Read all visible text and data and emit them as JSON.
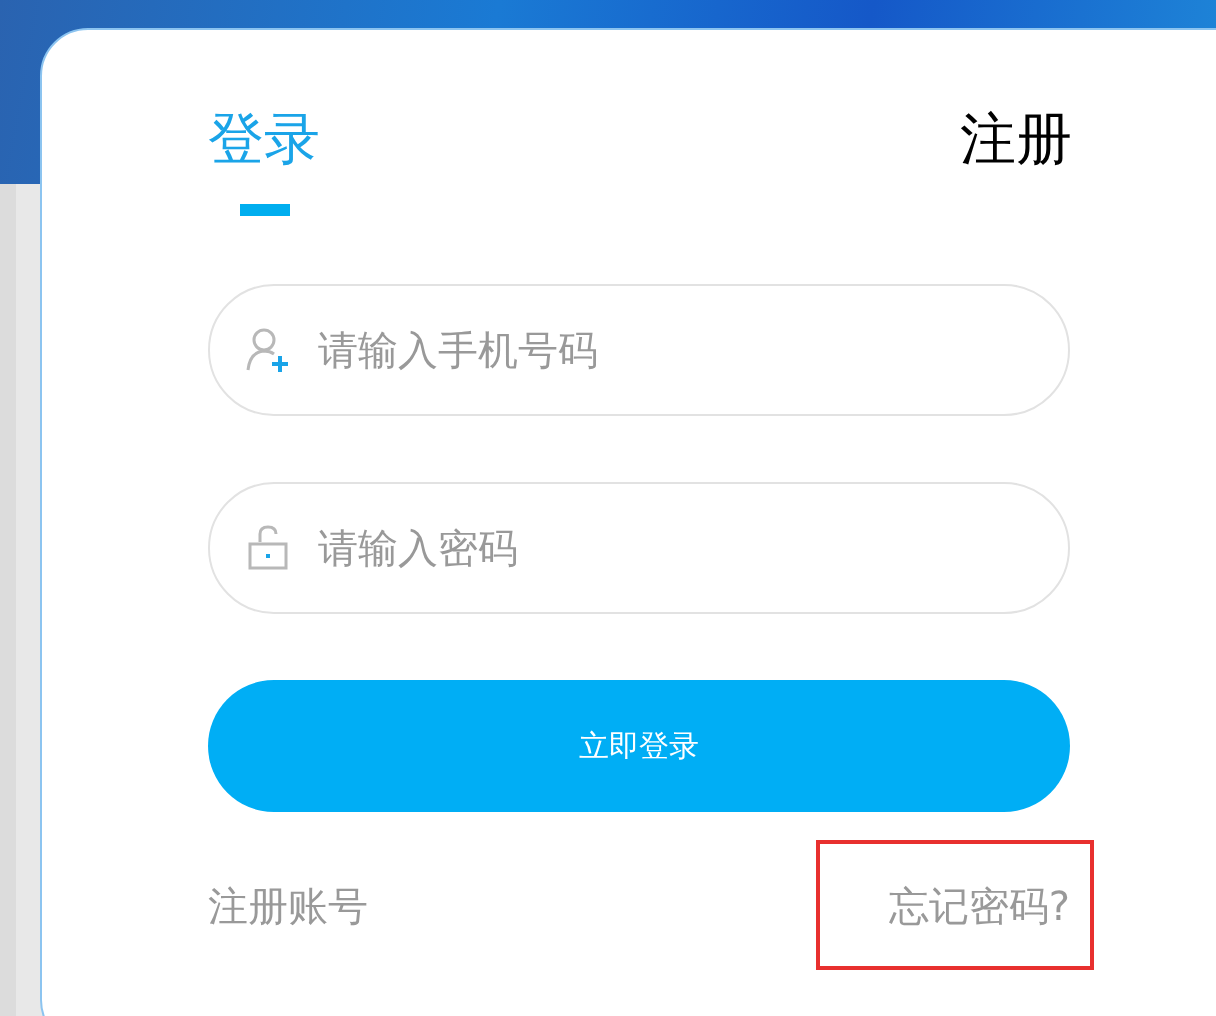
{
  "tabs": [
    {
      "label": "登录",
      "selected": true
    },
    {
      "label": "注册",
      "selected": false
    }
  ],
  "fields": [
    {
      "kind": "phone",
      "placeholder": "请输入手机号码"
    },
    {
      "kind": "password",
      "placeholder": "请输入密码"
    }
  ],
  "submit": {
    "label": "立即登录"
  },
  "links": [
    {
      "label": "注册账号",
      "highlighted": false
    },
    {
      "label": "忘记密码?",
      "highlighted": true
    }
  ]
}
